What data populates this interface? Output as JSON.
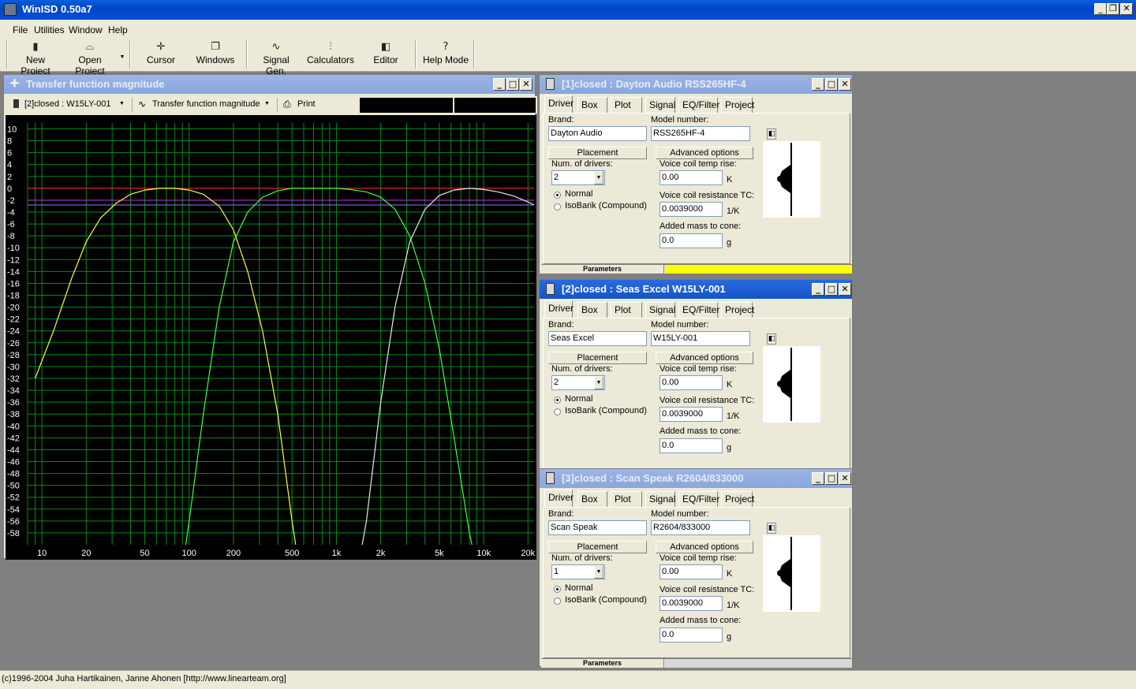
{
  "app": {
    "title": "WinISD 0.50a7"
  },
  "menu": [
    "File",
    "Utilities",
    "Window",
    "Help"
  ],
  "toolbar": {
    "new_project": "New Project",
    "open_project": "Open Project",
    "cursor": "Cursor",
    "windows": "Windows",
    "signal_gen": "Signal Gen.",
    "calculators": "Calculators",
    "editor": "Editor",
    "help_mode": "Help Mode"
  },
  "transfer": {
    "title": "Transfer function magnitude",
    "project_select": "[2]closed : W15LY-001",
    "plot_select": "Transfer function magnitude",
    "print": "Print"
  },
  "chart_data": {
    "type": "line",
    "title": "",
    "xlabel": "",
    "ylabel": "",
    "x_scale": "log",
    "xlim": [
      8,
      22000
    ],
    "ylim": [
      -60,
      11
    ],
    "grid": true,
    "x_ticks": [
      "10",
      "20",
      "50",
      "100",
      "200",
      "500",
      "1k",
      "2k",
      "5k",
      "10k",
      "20k"
    ],
    "y_ticks": [
      "10",
      "8",
      "6",
      "4",
      "2",
      "0",
      "-2",
      "-4",
      "-6",
      "-8",
      "-10",
      "-12",
      "-14",
      "-16",
      "-18",
      "-20",
      "-22",
      "-24",
      "-26",
      "-28",
      "-30",
      "-32",
      "-34",
      "-36",
      "-38",
      "-40",
      "-42",
      "-44",
      "-46",
      "-48",
      "-50",
      "-52",
      "-54",
      "-56",
      "-58"
    ],
    "reference_lines": [
      {
        "y": 0,
        "color": "#ff2020"
      },
      {
        "y": -2,
        "color": "#c040c0"
      },
      {
        "y": -2.8,
        "color": "#8080ff"
      }
    ],
    "series": [
      {
        "color": "#ffff40",
        "x": [
          9,
          12,
          16,
          20,
          25,
          32,
          40,
          50,
          63,
          80,
          100,
          125,
          160,
          200,
          250,
          315,
          400,
          500,
          560
        ],
        "y": [
          -32,
          -24,
          -15,
          -9,
          -5,
          -2.5,
          -1,
          -0.3,
          0,
          0,
          -0.3,
          -1,
          -3,
          -7,
          -14,
          -24,
          -38,
          -56,
          -64
        ]
      },
      {
        "color": "#40ff40",
        "x": [
          90,
          100,
          125,
          160,
          200,
          250,
          315,
          400,
          500,
          630,
          800,
          1000,
          1250,
          1600,
          2000,
          2500,
          3150,
          4000,
          5000,
          6300,
          8000,
          9000
        ],
        "y": [
          -64,
          -56,
          -38,
          -20,
          -9,
          -4,
          -1.5,
          -0.4,
          0,
          0,
          0,
          0,
          -0.2,
          -0.6,
          -1.5,
          -3.5,
          -8,
          -16,
          -27,
          -42,
          -58,
          -64
        ]
      },
      {
        "color": "#e8e8e8",
        "x": [
          1400,
          1600,
          2000,
          2500,
          3150,
          4000,
          5000,
          6300,
          8000,
          10000,
          12500,
          16000,
          20000,
          22000
        ],
        "y": [
          -64,
          -56,
          -36,
          -20,
          -9,
          -3.5,
          -1.2,
          -0.3,
          0,
          -0.2,
          -0.6,
          -1.3,
          -2.3,
          -2.8
        ]
      }
    ]
  },
  "drivers": [
    {
      "title": "[1]closed : Dayton Audio RSS265HF-4",
      "brand": "Dayton Audio",
      "model": "RSS265HF-4",
      "num_drivers": "2",
      "vc_temp": "0.00",
      "vc_tc": "0.0039000",
      "added_mass": "0.0",
      "bar_color": "#ffff00",
      "active": false
    },
    {
      "title": "[2]closed : Seas Excel W15LY-001",
      "brand": "Seas Excel",
      "model": "W15LY-001",
      "num_drivers": "2",
      "vc_temp": "0.00",
      "vc_tc": "0.0039000",
      "added_mass": "0.0",
      "bar_color": "#00ee00",
      "active": true
    },
    {
      "title": "[3]closed : Scan Speak R2604/833000",
      "brand": "Scan Speak",
      "model": "R2604/833000",
      "num_drivers": "1",
      "vc_temp": "0.00",
      "vc_tc": "0.0039000",
      "added_mass": "0.0",
      "bar_color": "#d8d8d8",
      "active": false
    }
  ],
  "labels": {
    "tabs": [
      "Driver",
      "Box",
      "Plot",
      "Signal",
      "EQ/Filter",
      "Project"
    ],
    "brand": "Brand:",
    "model": "Model number:",
    "placement": "Placement",
    "advanced": "Advanced options",
    "num_drivers": "Num. of drivers:",
    "vc_temp": "Voice coil temp rise:",
    "vc_temp_unit": "K",
    "vc_tc": "Voice coil resistance TC:",
    "vc_tc_unit": "1/K",
    "added_mass": "Added mass to cone:",
    "added_mass_unit": "g",
    "normal": "Normal",
    "isobarik": "IsoBarik (Compound)",
    "parameters": "Parameters"
  },
  "status": "(c)1996-2004 Juha Hartikainen, Janne Ahonen [http://www.linearteam.org]"
}
